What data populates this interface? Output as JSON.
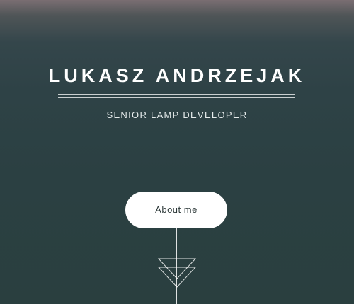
{
  "hero": {
    "name": "LUKASZ ANDRZEJAK",
    "role": "SENIOR LAMP DEVELOPER",
    "about_button_label": "About me",
    "scroll_icon": "double-chevron-down-icon"
  },
  "colors": {
    "background_top": "#7a6e72",
    "background_main": "#2b4042",
    "text": "#ffffff",
    "button_bg": "#ffffff",
    "button_text": "#2e3a3a"
  }
}
